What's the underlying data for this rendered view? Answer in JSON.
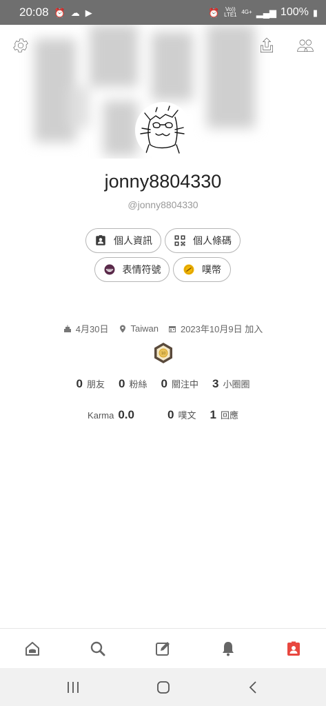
{
  "status_bar": {
    "time": "20:08",
    "volte": "Vo)) LTE1",
    "network": "4G+",
    "battery": "100%"
  },
  "profile": {
    "display_name": "jonny8804330",
    "handle": "@jonny8804330"
  },
  "actions": {
    "profile_info": "個人資訊",
    "profile_qrcode": "個人條碼",
    "emoticons": "表情符號",
    "coins": "噗幣"
  },
  "meta": {
    "birthday": "4月30日",
    "location": "Taiwan",
    "joined": "2023年10月9日 加入"
  },
  "stats": {
    "friends_count": "0",
    "friends_label": "朋友",
    "fans_count": "0",
    "fans_label": "粉絲",
    "following_count": "0",
    "following_label": "關注中",
    "cliques_count": "3",
    "cliques_label": "小圈圈",
    "karma_label": "Karma",
    "karma_value": "0.0",
    "plurks_count": "0",
    "plurks_label": "噗文",
    "responses_count": "1",
    "responses_label": "回應"
  },
  "bottom_nav": {
    "items": [
      "home-icon",
      "search-icon",
      "compose-icon",
      "bell-icon",
      "profile-icon"
    ],
    "active": "profile-icon",
    "active_color": "#e8473f"
  },
  "colors": {
    "badge_gold": "#d9a62b",
    "coin": "#f2b705"
  }
}
